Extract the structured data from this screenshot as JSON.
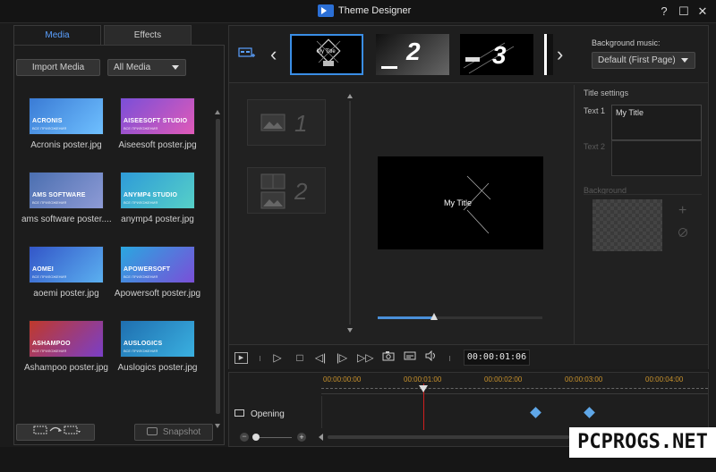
{
  "window": {
    "title": "Theme Designer",
    "buttons": {
      "help": "?",
      "maximize": "☐",
      "close": "✕"
    }
  },
  "tabs": [
    {
      "label": "Media",
      "active": true
    },
    {
      "label": "Effects",
      "active": false
    }
  ],
  "media_toolbar": {
    "import_label": "Import Media",
    "filter_value": "All Media"
  },
  "media_items": [
    {
      "label": "Acronis poster.jpg",
      "brand": "ACRONIS",
      "sub": "ВСЕ ПРИЛОЖЕНИЯ",
      "colors": [
        "#3a7bd5",
        "#6fc0ff"
      ]
    },
    {
      "label": "Aiseesoft poster.jpg",
      "brand": "AISEESOFT STUDIO",
      "sub": "ВСЕ ПРИЛОЖЕНИЯ",
      "colors": [
        "#7a4fd8",
        "#e05ab8"
      ]
    },
    {
      "label": "ams software poster....",
      "brand": "AMS SOFTWARE",
      "sub": "ВСЕ ПРИЛОЖЕНИЯ",
      "colors": [
        "#4b6fb0",
        "#8e9bd6"
      ]
    },
    {
      "label": "anymp4 poster.jpg",
      "brand": "ANYMP4 STUDIO",
      "sub": "ВСЕ ПРИЛОЖЕНИЯ",
      "colors": [
        "#2e9bd8",
        "#56d0c8"
      ]
    },
    {
      "label": "aoemi poster.jpg",
      "brand": "AOMEI",
      "sub": "ВСЕ ПРИЛОЖЕНИЯ",
      "colors": [
        "#3356c8",
        "#5bb0f0"
      ]
    },
    {
      "label": "Apowersoft poster.jpg",
      "brand": "APOWERSOFT",
      "sub": "ВСЕ ПРИЛОЖЕНИЯ",
      "colors": [
        "#2aa7e0",
        "#7a4fd8"
      ]
    },
    {
      "label": "Ashampoo poster.jpg",
      "brand": "ASHAMPOO",
      "sub": "ВСЕ ПРИЛОЖЕНИЯ",
      "colors": [
        "#c0392b",
        "#7a3fc8"
      ]
    },
    {
      "label": "Auslogics poster.jpg",
      "brand": "AUSLOGICS",
      "sub": "ВСЕ ПРИЛОЖЕНИЯ",
      "colors": [
        "#1f6fb0",
        "#3ab0e0"
      ]
    }
  ],
  "left_bottom": {
    "snapshot_label": "Snapshot"
  },
  "templates": {
    "items": [
      {
        "title": "My Title",
        "selected": true
      },
      {
        "num": "2",
        "selected": false
      },
      {
        "num": "3",
        "selected": false
      }
    ]
  },
  "background_music": {
    "label": "Background music:",
    "value": "Default (First Page)"
  },
  "slots": [
    {
      "num": "1"
    },
    {
      "num": "2"
    }
  ],
  "preview": {
    "title": "My Title",
    "progress": 0.34
  },
  "title_settings": {
    "heading": "Title settings",
    "text1_label": "Text 1",
    "text1_value": "My Title",
    "text2_label": "Text 2",
    "background_label": "Background"
  },
  "playback": {
    "timecode": "00:00:01:06"
  },
  "timeline": {
    "ticks": [
      "00:00:00:00",
      "00:00:01:00",
      "00:00:02:00",
      "00:00:03:00",
      "00:00:04:00"
    ],
    "track_label": "Opening"
  },
  "watermark": "PCPROGS.NET"
}
